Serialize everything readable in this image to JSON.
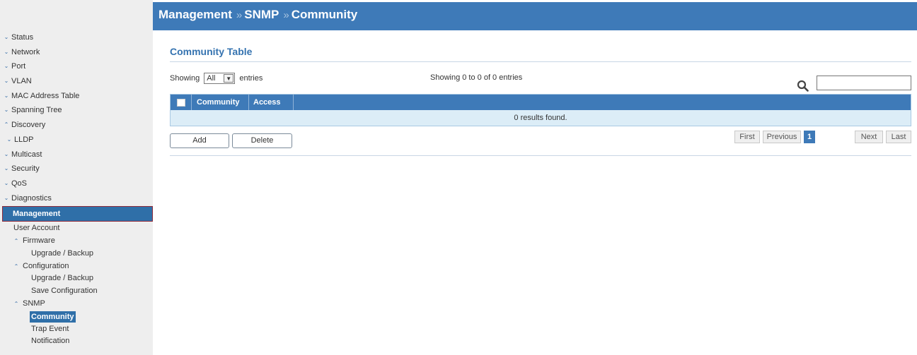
{
  "breadcrumb": [
    "Management",
    "SNMP",
    "Community"
  ],
  "breadcrumb_separator": "»",
  "sidebar": {
    "top_items": [
      {
        "label": "Status",
        "arrow": "down"
      },
      {
        "label": "Network",
        "arrow": "down"
      },
      {
        "label": "Port",
        "arrow": "down"
      },
      {
        "label": "VLAN",
        "arrow": "down"
      },
      {
        "label": "MAC Address Table",
        "arrow": "down"
      },
      {
        "label": "Spanning Tree",
        "arrow": "down"
      },
      {
        "label": "Discovery",
        "arrow": "up"
      },
      {
        "label": "LLDP",
        "arrow": "down"
      },
      {
        "label": "Multicast",
        "arrow": "down"
      },
      {
        "label": "Security",
        "arrow": "down"
      },
      {
        "label": "QoS",
        "arrow": "down"
      },
      {
        "label": "Diagnostics",
        "arrow": "down"
      }
    ],
    "active_section": "Management",
    "management_items": [
      {
        "label": "User Account"
      },
      {
        "label": "Firmware",
        "arrow": "up"
      },
      {
        "label": "Upgrade / Backup"
      },
      {
        "label": "Configuration",
        "arrow": "up"
      },
      {
        "label": "Upgrade / Backup"
      },
      {
        "label": "Save Configuration"
      },
      {
        "label": "SNMP",
        "arrow": "up"
      },
      {
        "label": "Community",
        "selected": true
      },
      {
        "label": "Trap Event"
      },
      {
        "label": "Notification"
      }
    ]
  },
  "main": {
    "section_title": "Community Table",
    "showing_label": "Showing",
    "entries_value": "All",
    "entries_label": "entries",
    "entries_info": "Showing 0 to 0 of 0 entries",
    "search_placeholder": "",
    "table": {
      "columns": [
        "Community",
        "Access"
      ],
      "empty_message": "0 results found."
    },
    "buttons": {
      "add": "Add",
      "delete": "Delete"
    },
    "pagination": {
      "first": "First",
      "previous": "Previous",
      "current": "1",
      "next": "Next",
      "last": "Last"
    }
  },
  "colors": {
    "header_bg": "#3e7ab8",
    "sidebar_bg": "#eeeeee",
    "row_bg": "#dcedf7",
    "title_color": "#3573b0"
  }
}
